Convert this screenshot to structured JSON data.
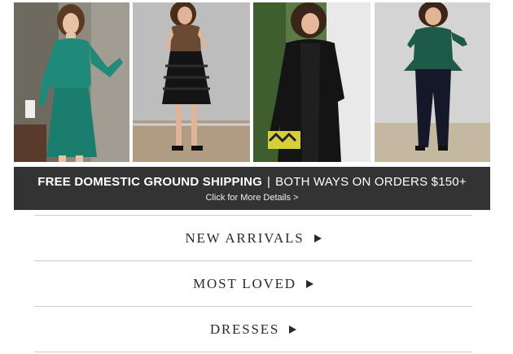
{
  "banner": {
    "headline_bold": "FREE DOMESTIC GROUND SHIPPING",
    "separator": "|",
    "headline_rest": "BOTH WAYS ON ORDERS $150+",
    "details_link": "Click for More Details >"
  },
  "nav": {
    "items": [
      {
        "label": "NEW ARRIVALS"
      },
      {
        "label": "MOST LOVED"
      },
      {
        "label": "DRESSES"
      }
    ]
  },
  "colors": {
    "banner_bg": "#333333",
    "nav_text": "#2a2a2a",
    "divider": "#cccccc"
  },
  "icons": [
    "play-arrow-icon"
  ]
}
